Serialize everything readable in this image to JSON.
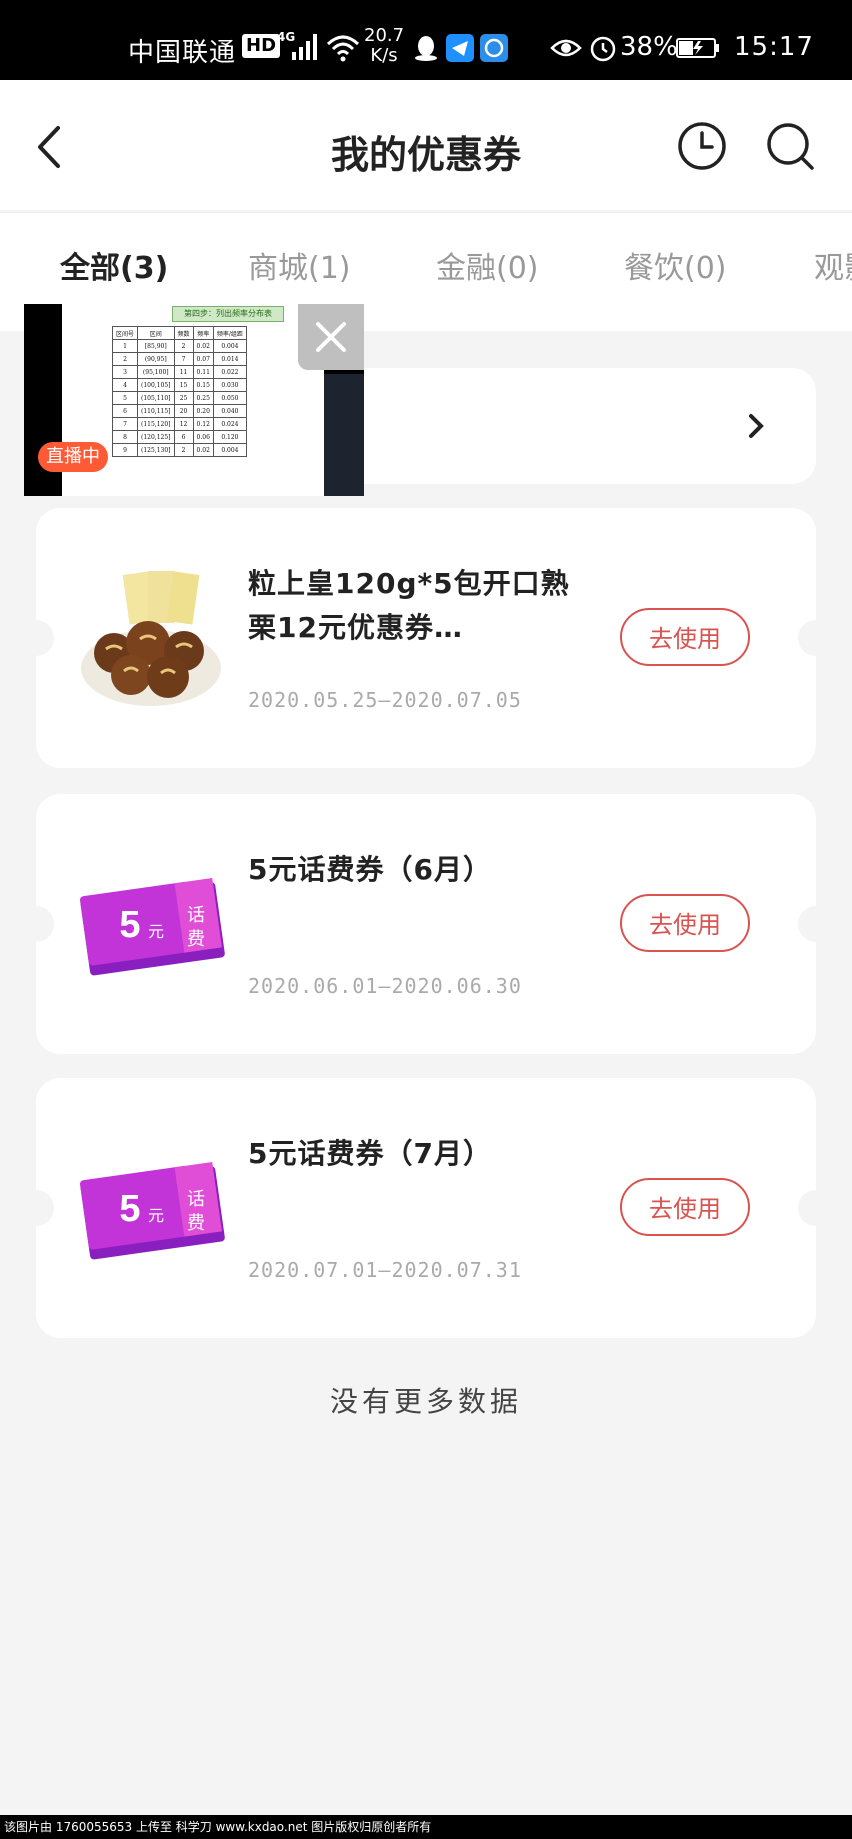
{
  "status_bar": {
    "carrier": "中国联通",
    "hd": "HD",
    "network": "4G",
    "speed_value": "20.7",
    "speed_unit": "K/s",
    "battery": "38%",
    "time": "15:17"
  },
  "nav": {
    "title": "我的优惠券"
  },
  "tabs": [
    {
      "label": "全部(3)",
      "active": true
    },
    {
      "label": "商城(1)",
      "active": false
    },
    {
      "label": "金融(0)",
      "active": false
    },
    {
      "label": "餐饮(0)",
      "active": false
    },
    {
      "label": "观影",
      "active": false
    }
  ],
  "live_overlay": {
    "badge": "直播中",
    "sheet_header": "第四步：列出频率分布表",
    "sheet_columns": [
      "区间号",
      "区间",
      "频数",
      "频率",
      "频率/组距"
    ],
    "sheet_rows": [
      [
        "1",
        "[85,90]",
        "2",
        "0.02",
        "0.004"
      ],
      [
        "2",
        "(90,95]",
        "7",
        "0.07",
        "0.014"
      ],
      [
        "3",
        "(95,100]",
        "11",
        "0.11",
        "0.022"
      ],
      [
        "4",
        "(100,105]",
        "15",
        "0.15",
        "0.030"
      ],
      [
        "5",
        "(105,110]",
        "25",
        "0.25",
        "0.050"
      ],
      [
        "6",
        "(110,115]",
        "20",
        "0.20",
        "0.040"
      ],
      [
        "7",
        "(115,120]",
        "12",
        "0.12",
        "0.024"
      ],
      [
        "8",
        "(120,125]",
        "6",
        "0.06",
        "0.120"
      ],
      [
        "9",
        "(125,130]",
        "2",
        "0.02",
        "0.004"
      ]
    ]
  },
  "coupons": [
    {
      "title": "粒上皇120g*5包开口熟栗12元优惠券…",
      "date": "2020.05.25—2020.07.05",
      "button": "去使用",
      "image": "chestnut-image"
    },
    {
      "title": "5元话费券（6月）",
      "date": "2020.06.01—2020.06.30",
      "button": "去使用",
      "image": "phone-credit-ticket",
      "ticket_amount": "5",
      "ticket_unit": "元",
      "ticket_label_1": "话",
      "ticket_label_2": "费"
    },
    {
      "title": "5元话费券（7月）",
      "date": "2020.07.01—2020.07.31",
      "button": "去使用",
      "image": "phone-credit-ticket",
      "ticket_amount": "5",
      "ticket_unit": "元",
      "ticket_label_1": "话",
      "ticket_label_2": "费"
    }
  ],
  "no_more_text": "没有更多数据",
  "footer_watermark": "该图片由 1760055653 上传至 科学刀 www.kxdao.net 图片版权归原创者所有",
  "colors": {
    "accent": "#d9534f",
    "live_badge": "#ff5a36",
    "ticket_purple": "#a020c8",
    "ticket_pink": "#d63bd0",
    "background": "#f4f4f4"
  }
}
